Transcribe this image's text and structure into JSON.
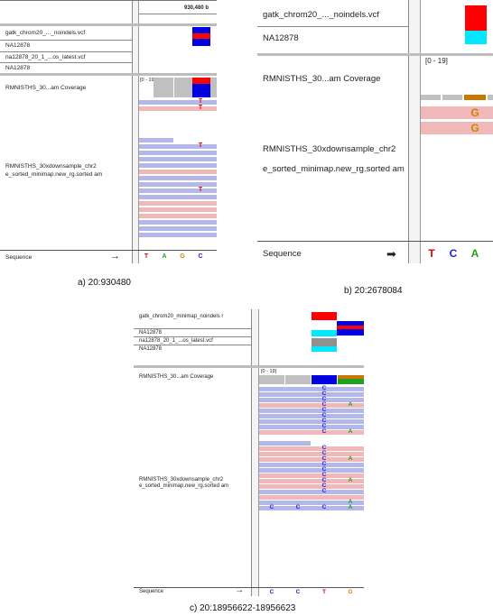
{
  "panel_a": {
    "locus_label": "930,480 b",
    "tracks": [
      "gatk_chrom20_..._noindels.vcf",
      "NA12878",
      "na12878_20_1_...os_latest.vcf",
      "NA12878"
    ],
    "coverage_label": "RMNISTHS_30...am Coverage",
    "coverage_range": "[0 - 19]",
    "alignment_label": "RMNISTHS_30xdownsample_chr2 e_sorted_minimap.new_rg.sorted am",
    "sequence_label": "Sequence",
    "sequence_arrow": "→",
    "sequence_bases": [
      "T",
      "A",
      "G",
      "C"
    ],
    "read_bases": [
      "T",
      "T",
      "T",
      "T"
    ],
    "caption": "a)  20:930480"
  },
  "panel_b": {
    "tracks": [
      "gatk_chrom20_..._noindels.vcf",
      "NA12878"
    ],
    "coverage_label": "RMNISTHS_30...am Coverage",
    "coverage_range": "[0 - 19]",
    "alignment_label": "RMNISTHS_30xdownsample_chr2 e_sorted_minimap.new_rg.sorted am",
    "sequence_label": "Sequence",
    "sequence_arrow": "➡",
    "sequence_bases": [
      "T",
      "C",
      "A"
    ],
    "read_bases": [
      "G",
      "G"
    ],
    "caption": "b)  20:2678084"
  },
  "panel_c": {
    "tracks": [
      "gatk_chrom20_minimap_noindels r",
      "NA12878",
      "na12878_20_1_...os_latest.vcf",
      "NA12878"
    ],
    "coverage_label": "RMNISTHS_30...am Coverage",
    "coverage_range": "[0 - 19]",
    "alignment_label": "RMNISTHS_30xdownsample_chr2 e_sorted_minimap.new_rg.sorted am",
    "sequence_label": "Sequence",
    "sequence_arrow": "→",
    "sequence_bases": [
      "C",
      "C",
      "T",
      "G"
    ],
    "read_base_c": "C",
    "read_base_a": "A",
    "caption": "c) 20:18956622-18956623"
  },
  "colors": {
    "read_blue": "#b4b8e8",
    "read_pink": "#f0b8b8",
    "base_T": "#e00000",
    "base_A": "#20a020",
    "base_G": "#d08000",
    "base_C": "#2020e0",
    "vcf_red": "#ff0000",
    "vcf_blue": "#0000e0",
    "vcf_cyan": "#00e8ff",
    "vcf_gray": "#909090"
  }
}
